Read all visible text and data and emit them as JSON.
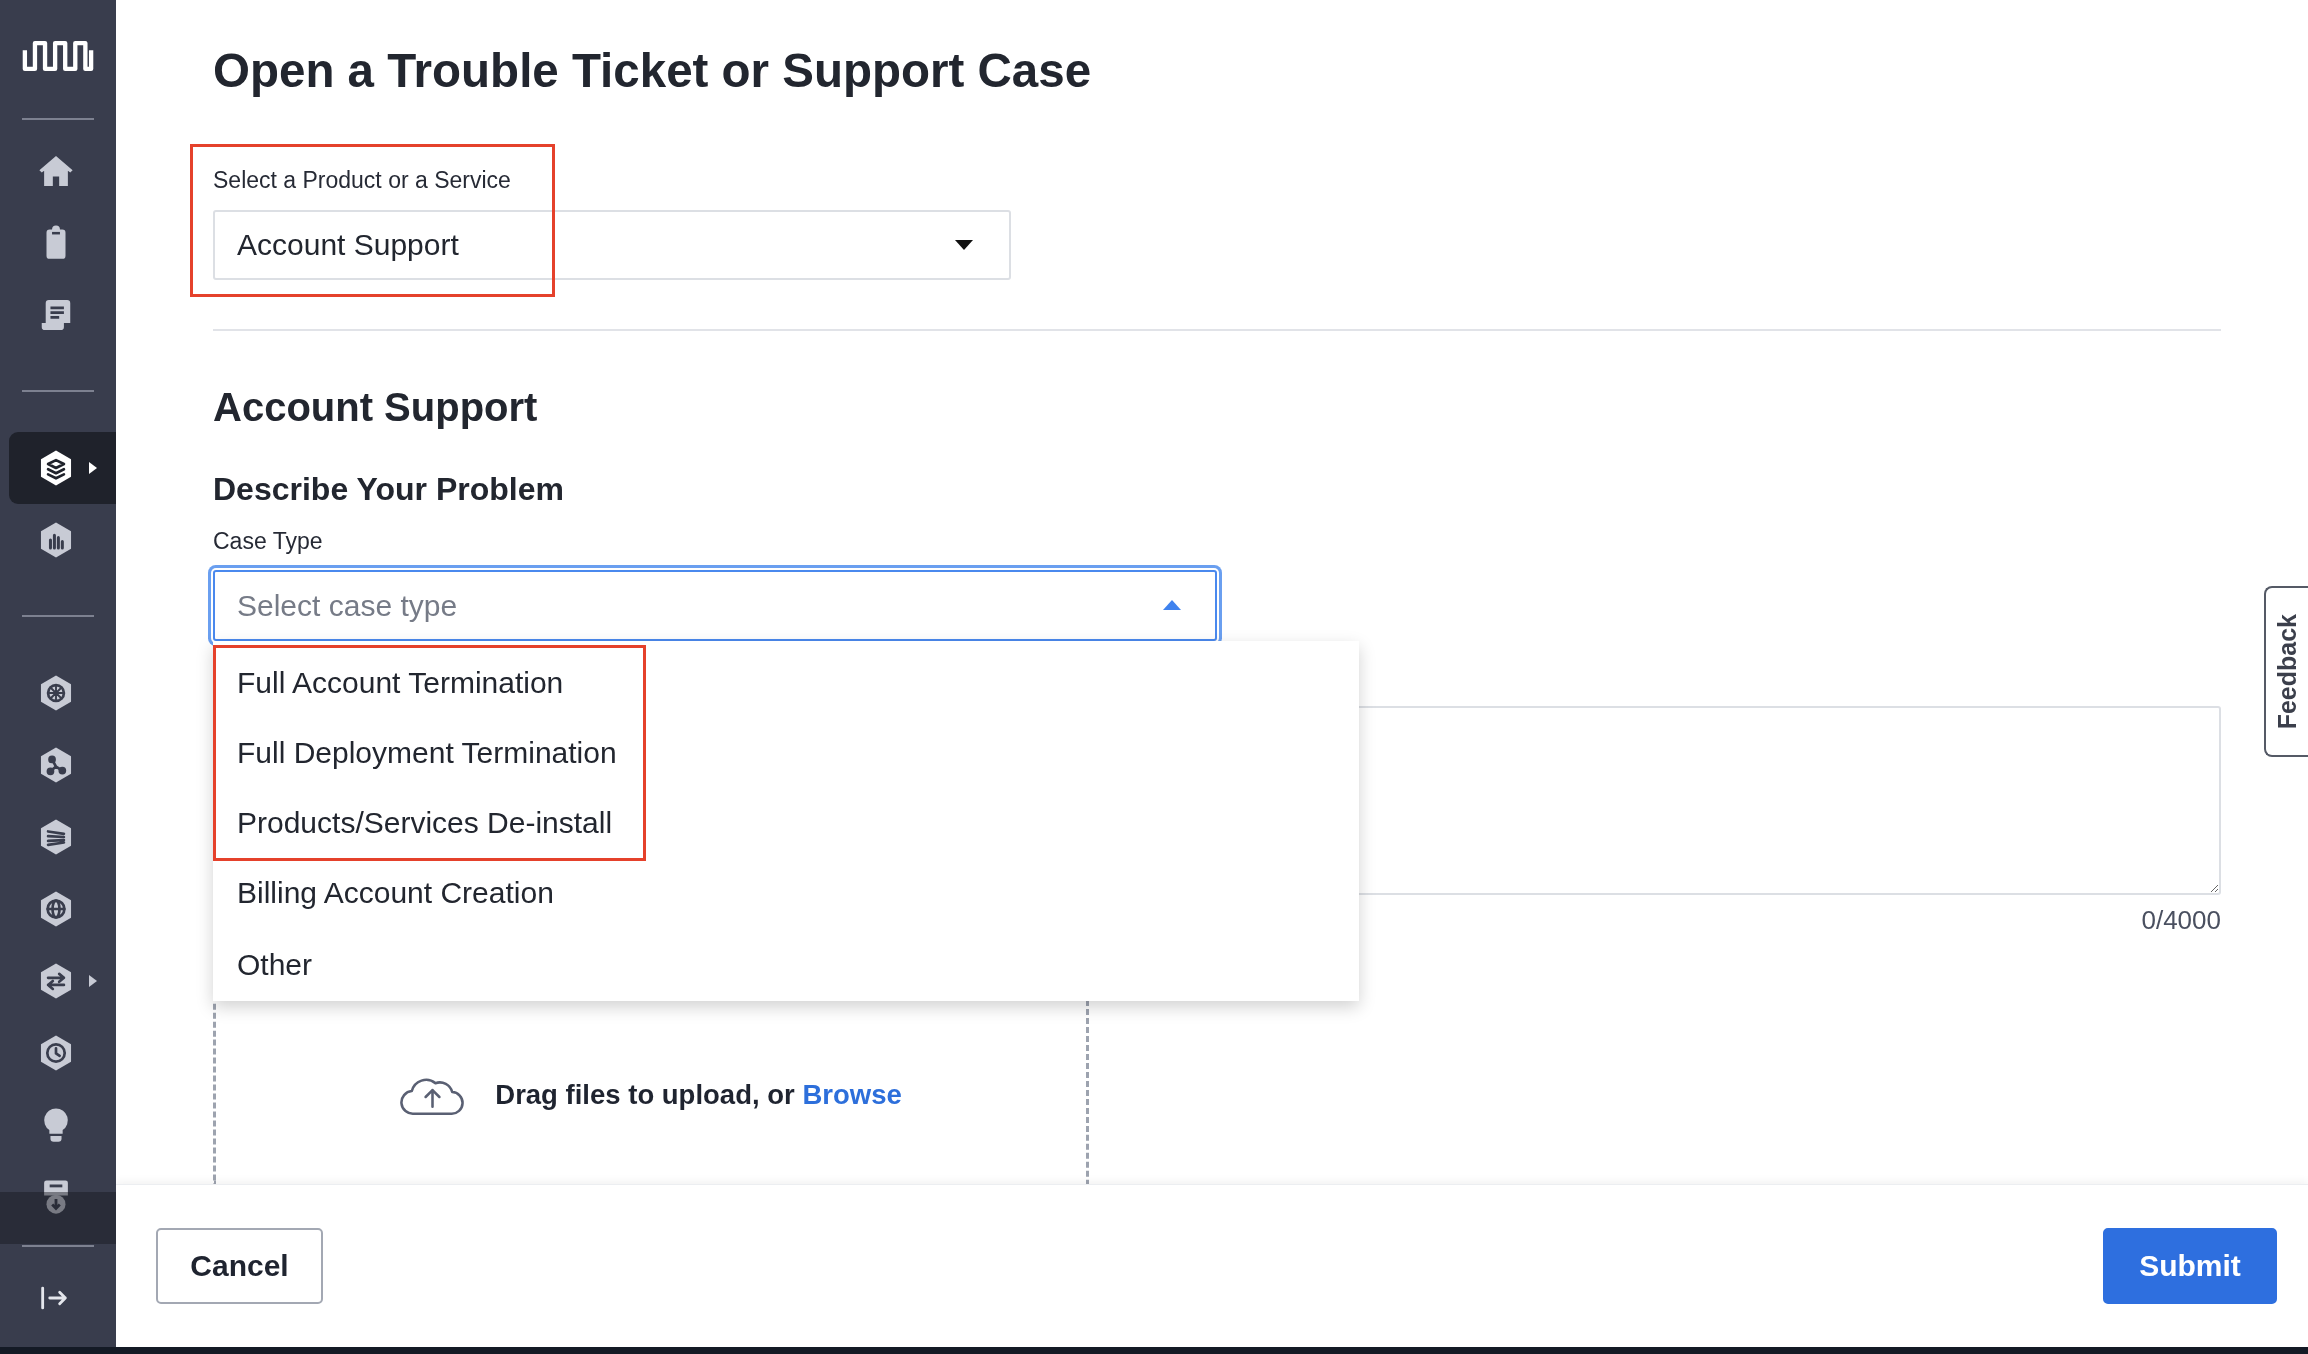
{
  "sidebar": {
    "groups": [
      {
        "items": [
          {
            "selected": false,
            "submenu": false
          },
          {
            "selected": false,
            "submenu": false
          },
          {
            "selected": false,
            "submenu": false
          }
        ]
      },
      {
        "items": [
          {
            "selected": true,
            "submenu": true
          },
          {
            "selected": false,
            "submenu": false
          }
        ]
      },
      {
        "items": [
          {
            "selected": false,
            "submenu": false
          },
          {
            "selected": false,
            "submenu": false
          },
          {
            "selected": false,
            "submenu": false
          },
          {
            "selected": false,
            "submenu": false
          },
          {
            "selected": false,
            "submenu": true
          },
          {
            "selected": false,
            "submenu": false
          },
          {
            "selected": false,
            "submenu": false
          },
          {
            "selected": false,
            "submenu": false
          }
        ]
      }
    ]
  },
  "page_title": "Open a Trouble Ticket or Support Case",
  "product_select": {
    "label": "Select a Product or a Service",
    "value": "Account Support",
    "highlighted": true
  },
  "section_title": "Account Support",
  "subsection_title": "Describe Your Problem",
  "case_type": {
    "label": "Case Type",
    "placeholder": "Select case type",
    "expanded": true,
    "options": [
      {
        "label": "Full Account Termination",
        "highlighted": true
      },
      {
        "label": "Full Deployment Termination",
        "highlighted": true
      },
      {
        "label": "Products/Services De-install",
        "highlighted": true
      },
      {
        "label": "Billing Account Creation",
        "highlighted": false
      },
      {
        "label": "Other",
        "highlighted": false
      }
    ]
  },
  "description": {
    "counter": "0/4000"
  },
  "attachments": {
    "prompt": "Drag files to upload, or",
    "link": "Browse"
  },
  "feedback_tab": {
    "label": "Feedback"
  },
  "footer": {
    "buttons": [
      {
        "label": "Cancel",
        "kind": "secondary"
      },
      {
        "label": "Submit",
        "kind": "primary"
      }
    ]
  }
}
